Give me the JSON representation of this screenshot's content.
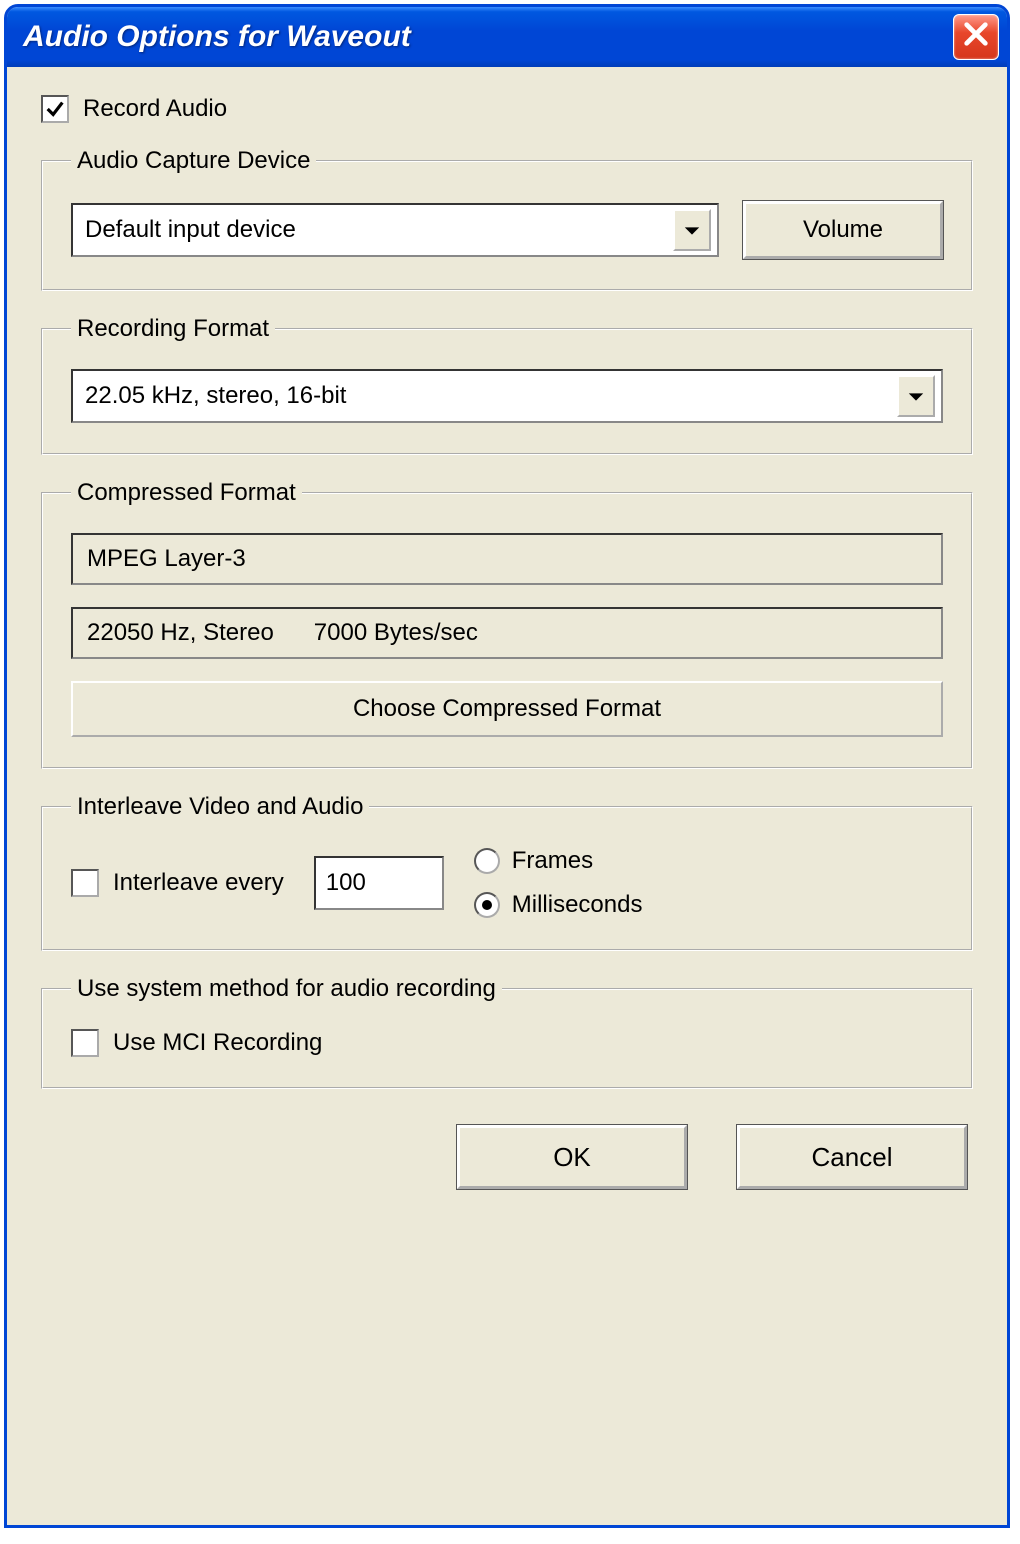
{
  "window": {
    "title": "Audio Options for Waveout"
  },
  "recordAudio": {
    "label": "Record Audio",
    "checked": true
  },
  "captureDevice": {
    "legend": "Audio Capture Device",
    "selected": "Default input device",
    "volumeBtn": "Volume"
  },
  "recordingFormat": {
    "legend": "Recording Format",
    "selected": "22.05 kHz, stereo, 16-bit"
  },
  "compressedFormat": {
    "legend": "Compressed Format",
    "codec": "MPEG Layer-3",
    "detail": "22050 Hz, Stereo      7000 Bytes/sec",
    "chooseBtn": "Choose  Compressed Format"
  },
  "interleave": {
    "legend": "Interleave Video and Audio",
    "checkboxLabel": "Interleave every",
    "checked": false,
    "value": "100",
    "framesLabel": "Frames",
    "msLabel": "Milliseconds",
    "unit": "ms"
  },
  "systemMethod": {
    "legend": "Use system method for audio recording",
    "mciLabel": "Use MCI Recording",
    "mciChecked": false
  },
  "buttons": {
    "ok": "OK",
    "cancel": "Cancel"
  }
}
